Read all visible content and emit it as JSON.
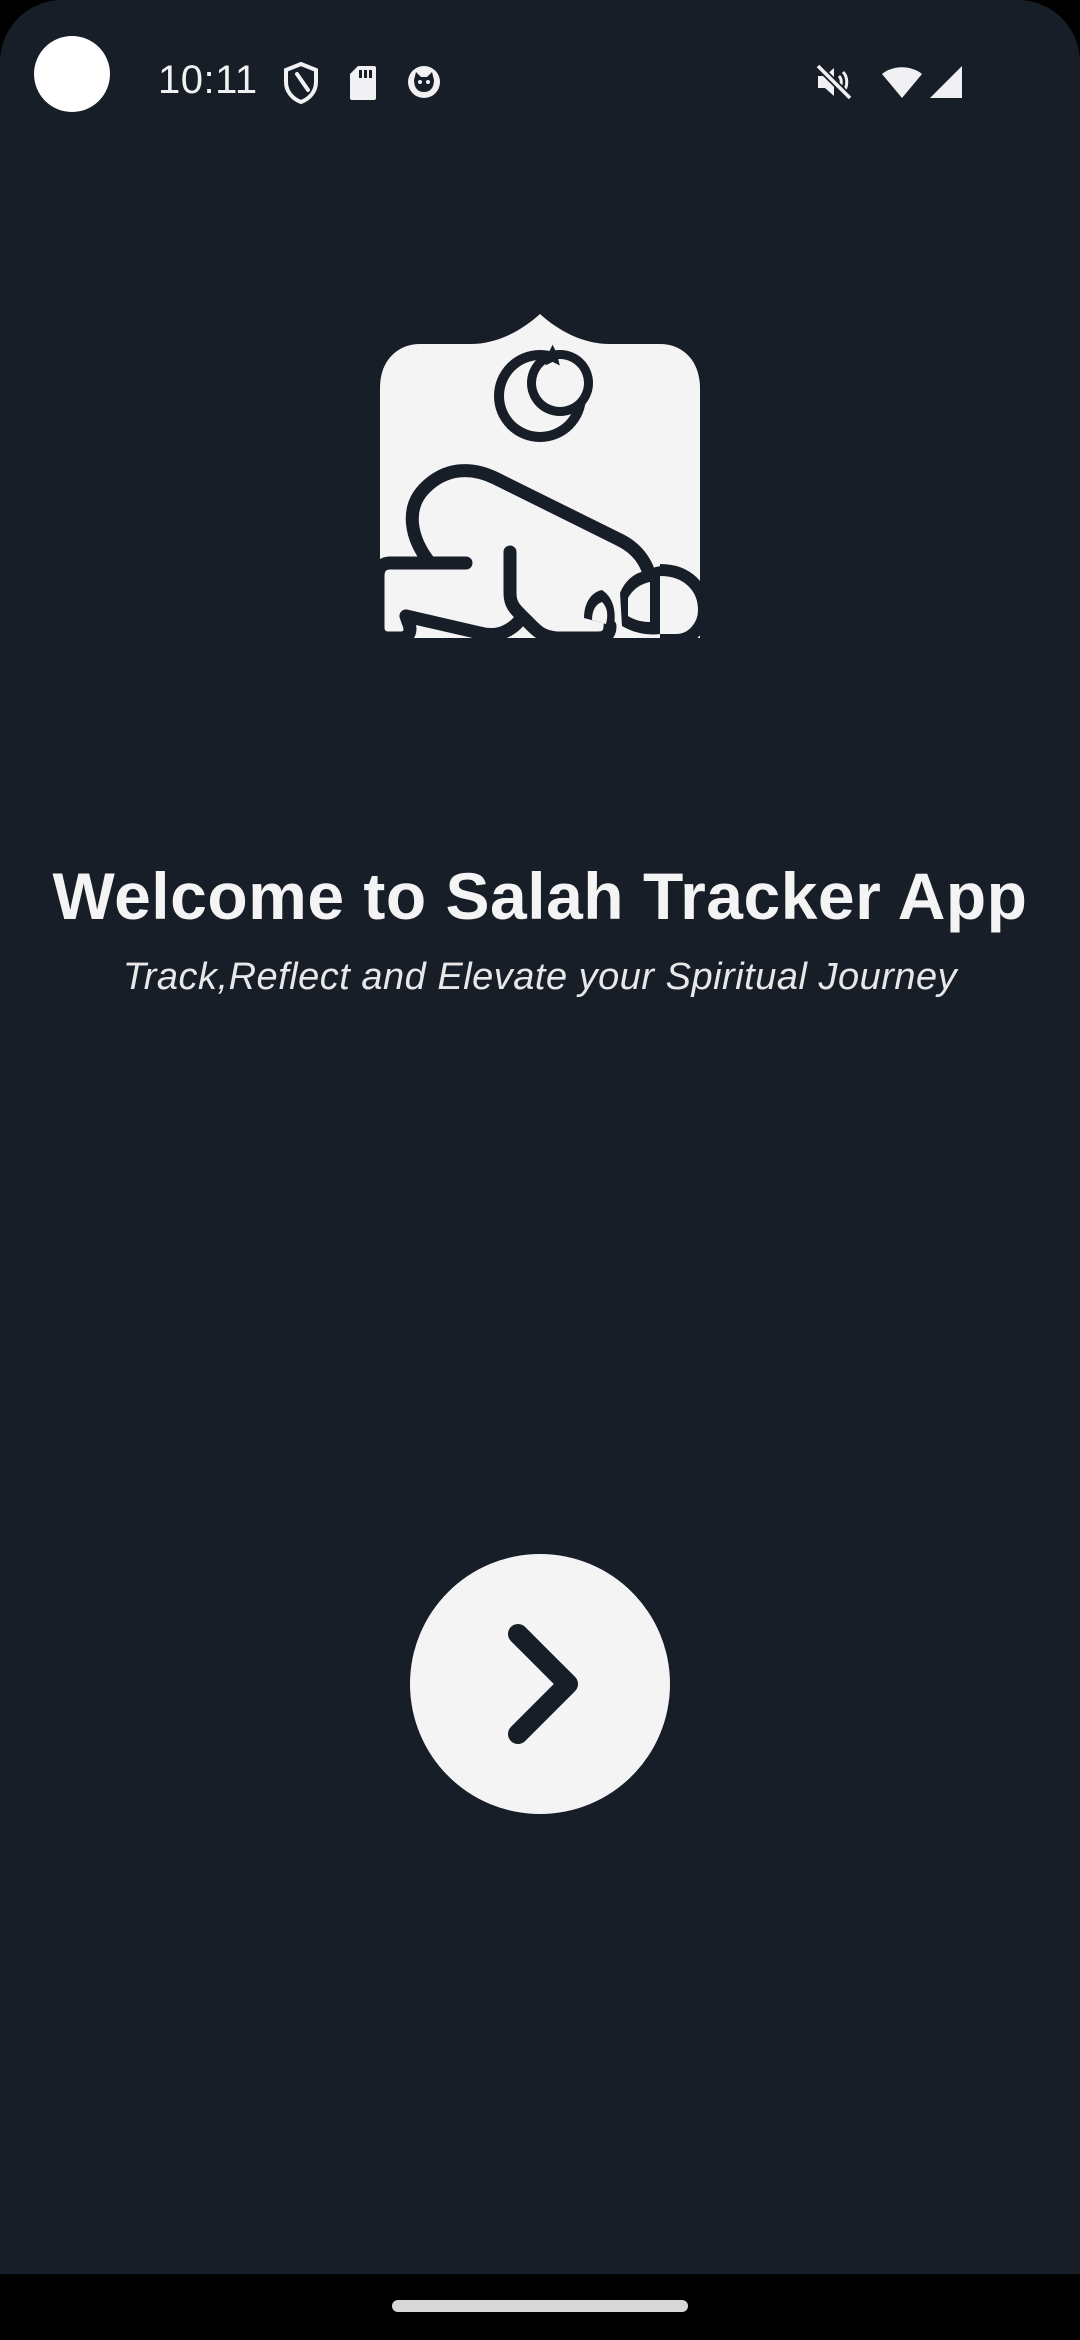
{
  "status_bar": {
    "time": "10:11",
    "left_icons": [
      "shield-icon",
      "sd-card-icon",
      "cat-face-icon"
    ],
    "right_icons": [
      "muted-speaker-icon",
      "wifi-icon",
      "cell-signal-icon"
    ]
  },
  "logo": {
    "icon": "prayer-mosque-logo-icon"
  },
  "welcome": {
    "title": "Welcome to Salah Tracker App",
    "subtitle": "Track,Reflect and Elevate your Spiritual Journey"
  },
  "next_button": {
    "icon": "chevron-right-icon"
  },
  "colors": {
    "background": "#181e27",
    "foreground": "#f4f4f4"
  }
}
